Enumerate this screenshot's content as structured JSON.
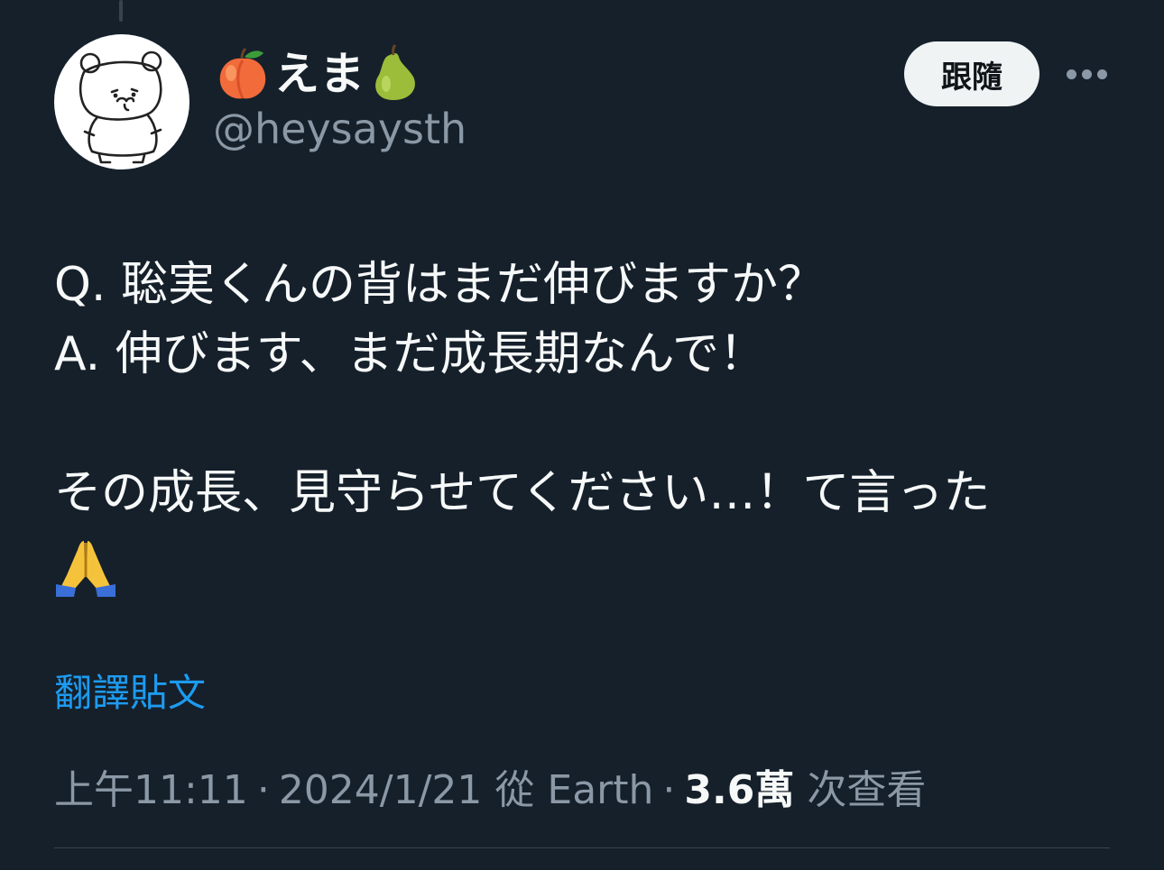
{
  "author": {
    "display_name": "えま",
    "name_prefix_emoji": "peach-icon",
    "name_suffix_emoji": "pear-icon",
    "handle": "@heysaysth",
    "avatar_icon": "bear-avatar-icon"
  },
  "actions": {
    "follow_label": "跟隨",
    "more_icon": "more-icon"
  },
  "tweet": {
    "lines": [
      "Q. 聡実くんの背はまだ伸びますか？",
      "A. 伸びます、まだ成長期なんで！",
      "",
      "その成長、見守らせてください…！て言った"
    ],
    "trailing_emoji": "folded-hands-icon",
    "translate_label": "翻譯貼文"
  },
  "meta": {
    "time": "上午11:11",
    "separator": "·",
    "date": "2024/1/21",
    "source": "從 Earth",
    "views_count": "3.6萬",
    "views_label": "次查看"
  },
  "colors": {
    "background": "#15202b",
    "text": "#f7f9f9",
    "secondary": "#8b98a5",
    "link": "#1d9bf0",
    "button_bg": "#eff3f4"
  }
}
